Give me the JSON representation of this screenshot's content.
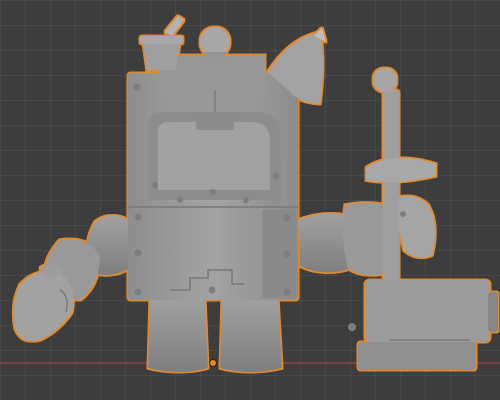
{
  "viewport": {
    "background_color": "#3d3d3d",
    "grid_color": "#4a4a4a",
    "x_axis_color": "#8f3c46",
    "selection_outline_color": "#e28a2a",
    "mesh_color": "#9a9a9a"
  },
  "scene": {
    "selected_object": "robot-mesh",
    "shading": "solid",
    "icons": {
      "origin": "object-origin-icon",
      "cursor": "3d-cursor-icon"
    }
  }
}
